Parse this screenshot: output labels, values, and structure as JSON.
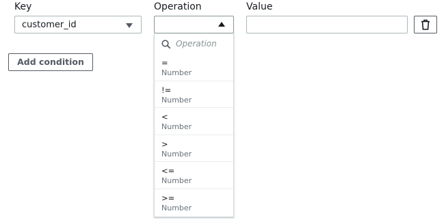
{
  "labels": {
    "key": "Key",
    "operation": "Operation",
    "value": "Value"
  },
  "key_select": {
    "selected": "customer_id"
  },
  "operation_select": {
    "selected": ""
  },
  "value_input": {
    "value": ""
  },
  "add_condition_label": "Add condition",
  "dropdown": {
    "search_placeholder": "Operation",
    "options": [
      {
        "operator": "=",
        "type": "Number"
      },
      {
        "operator": "!=",
        "type": "Number"
      },
      {
        "operator": "<",
        "type": "Number"
      },
      {
        "operator": ">",
        "type": "Number"
      },
      {
        "operator": "<=",
        "type": "Number"
      },
      {
        "operator": ">=",
        "type": "Number"
      }
    ]
  },
  "colors": {
    "border": "#aab7b8",
    "text": "#16191f",
    "muted": "#687078"
  },
  "icons": {
    "delete": "trash-icon",
    "search": "search-icon"
  }
}
